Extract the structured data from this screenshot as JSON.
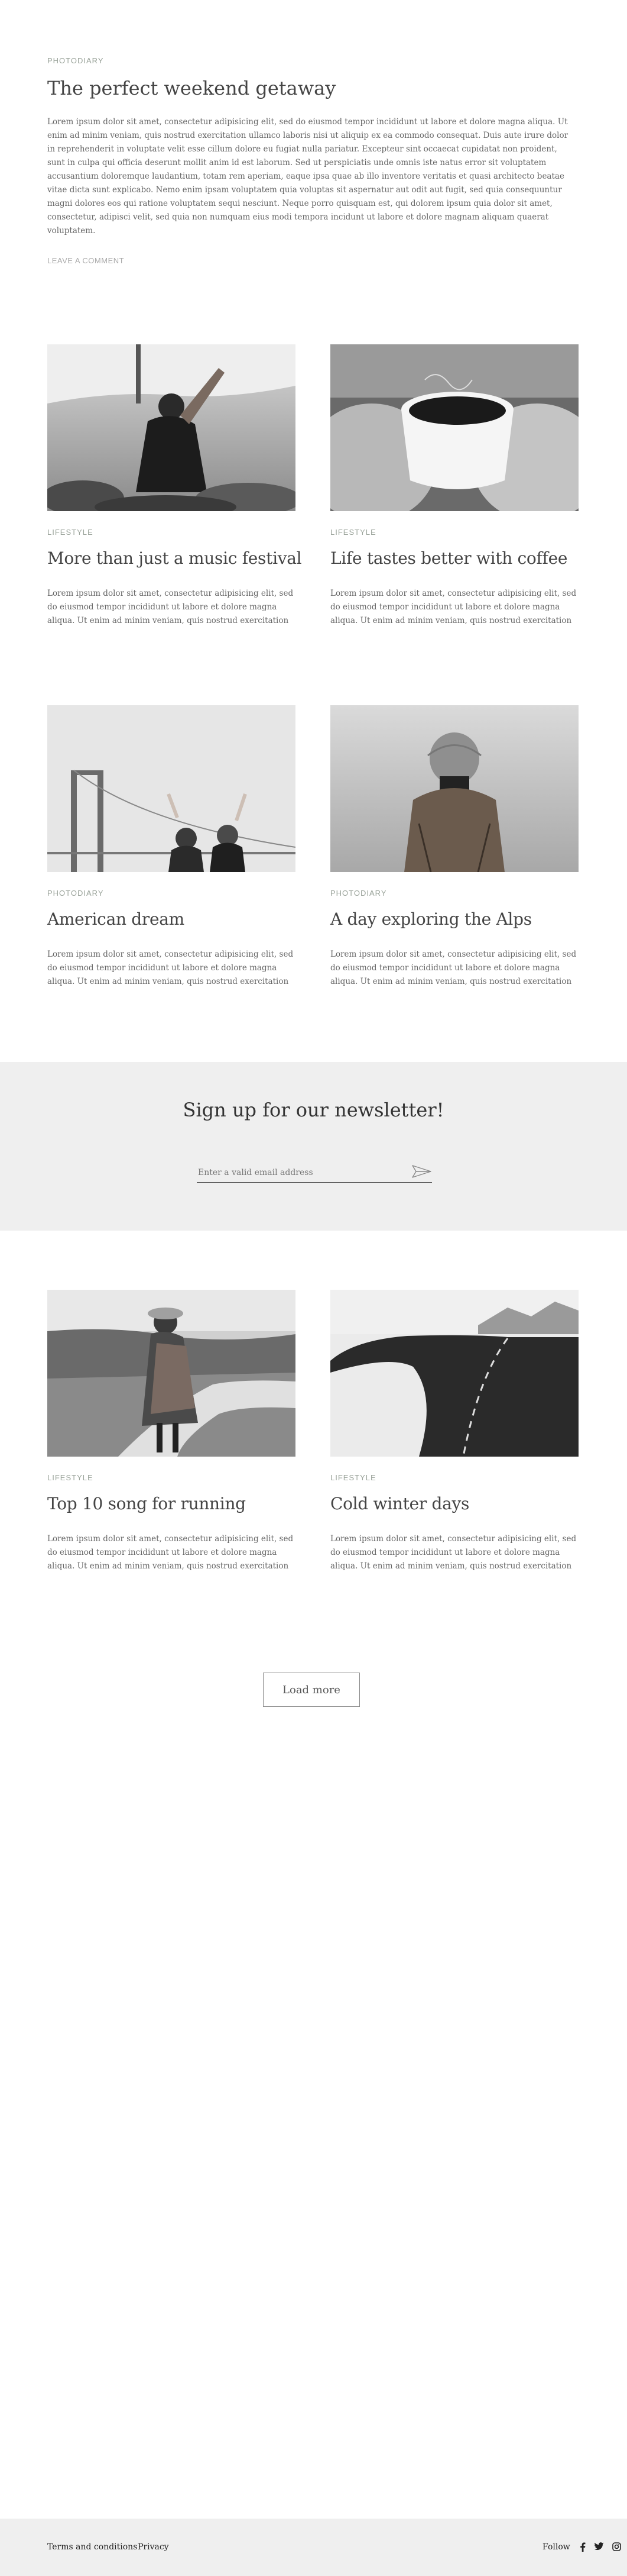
{
  "featured": {
    "category": "Photodiary",
    "title": "The perfect weekend getaway",
    "text": "Lorem ipsum dolor sit amet, consectetur adipisicing elit, sed do eiusmod tempor incididunt ut labore et dolore magna aliqua. Ut enim ad minim veniam, quis nostrud exercitation ullamco laboris nisi ut aliquip ex ea commodo consequat. Duis aute irure dolor in reprehenderit in voluptate velit esse cillum dolore eu fugiat nulla pariatur. Excepteur sint occaecat cupidatat non proident, sunt in culpa qui officia deserunt mollit anim id est laborum. Sed ut perspiciatis unde omnis iste natus error sit voluptatem accusantium doloremque laudantium, totam rem aperiam, eaque ipsa quae ab illo inventore veritatis et quasi architecto beatae vitae dicta sunt explicabo. Nemo enim ipsam voluptatem quia voluptas sit aspernatur aut odit aut fugit, sed quia consequuntur magni dolores eos qui ratione voluptatem sequi nesciunt. Neque porro quisquam est, qui dolorem ipsum quia dolor sit amet, consectetur, adipisci velit, sed quia non numquam eius modi tempora incidunt ut labore et dolore magnam aliquam quaerat voluptatem.",
    "comment_link": "Leave a comment"
  },
  "posts": [
    {
      "category": "Lifestyle",
      "title": "More than just a music festival",
      "text": "Lorem ipsum dolor sit amet, consectetur adipisicing elit, sed do eiusmod tempor incididunt ut labore et dolore magna aliqua. Ut enim ad minim veniam, quis nostrud exercitation ullamco laboris"
    },
    {
      "category": "Lifestyle",
      "title": "Life tastes better with coffee",
      "text": "Lorem ipsum dolor sit amet, consectetur adipisicing elit, sed do eiusmod tempor incididunt ut labore et dolore magna aliqua. Ut enim ad minim veniam, quis nostrud exercitation ullamco laboris"
    },
    {
      "category": "Photodiary",
      "title": "American dream",
      "text": "Lorem ipsum dolor sit amet, consectetur adipisicing elit, sed do eiusmod tempor incididunt ut labore et dolore magna aliqua. Ut enim ad minim veniam, quis nostrud exercitation ullamco laboris"
    },
    {
      "category": "Photodiary",
      "title": "A day exploring the Alps",
      "text": "Lorem ipsum dolor sit amet, consectetur adipisicing elit, sed do eiusmod tempor incididunt ut labore et dolore magna aliqua. Ut enim ad minim veniam, quis nostrud exercitation ullamco laboris"
    },
    {
      "category": "Lifestyle",
      "title": "Top 10 song for running",
      "text": "Lorem ipsum dolor sit amet, consectetur adipisicing elit, sed do eiusmod tempor incididunt ut labore et dolore magna aliqua. Ut enim ad minim veniam, quis nostrud exercitation ullamco laboris"
    },
    {
      "category": "Lifestyle",
      "title": "Cold winter days",
      "text": "Lorem ipsum dolor sit amet, consectetur adipisicing elit, sed do eiusmod tempor incididunt ut labore et dolore magna aliqua. Ut enim ad minim veniam, quis nostrud exercitation ullamco laboris"
    }
  ],
  "newsletter": {
    "title": "Sign up for our newsletter!",
    "placeholder": "Enter a valid email address",
    "send_icon": "send-icon"
  },
  "load_more": "Load more",
  "footer": {
    "terms": "Terms and conditions",
    "privacy": "Privacy",
    "follow": "Follow",
    "social_icons": [
      "facebook-icon",
      "twitter-icon",
      "instagram-icon"
    ]
  },
  "colors": {
    "category": "#9aa39a",
    "newsletter_bg": "#efefef",
    "footer_bg": "#efefef"
  }
}
